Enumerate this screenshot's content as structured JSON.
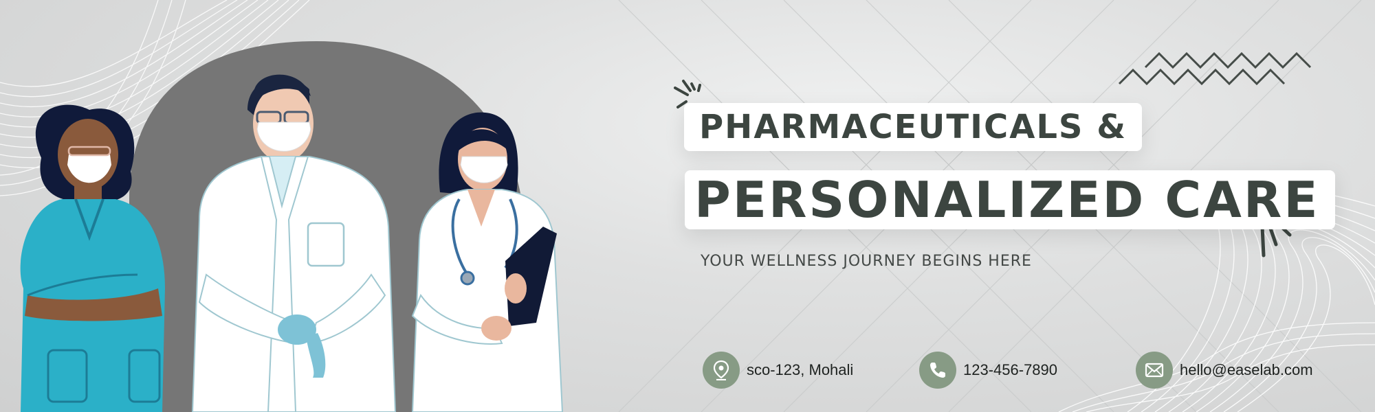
{
  "banner": {
    "title_line1": "PHARMACEUTICALS &",
    "title_line2": "PERSONALIZED CARE",
    "tagline": "YOUR WELLNESS JOURNEY BEGINS HERE",
    "contacts": [
      {
        "icon": "location-pin-icon",
        "text": "sco-123, Mohali"
      },
      {
        "icon": "phone-icon",
        "text": "123-456-7890"
      },
      {
        "icon": "envelope-icon",
        "text": "hello@easelab.com"
      }
    ]
  },
  "colors": {
    "background": "#d9dada",
    "text_dark": "#3c4540",
    "accent_sage": "#879b85",
    "arch_gray": "#767676",
    "scrubs_teal": "#2bb0c8"
  }
}
